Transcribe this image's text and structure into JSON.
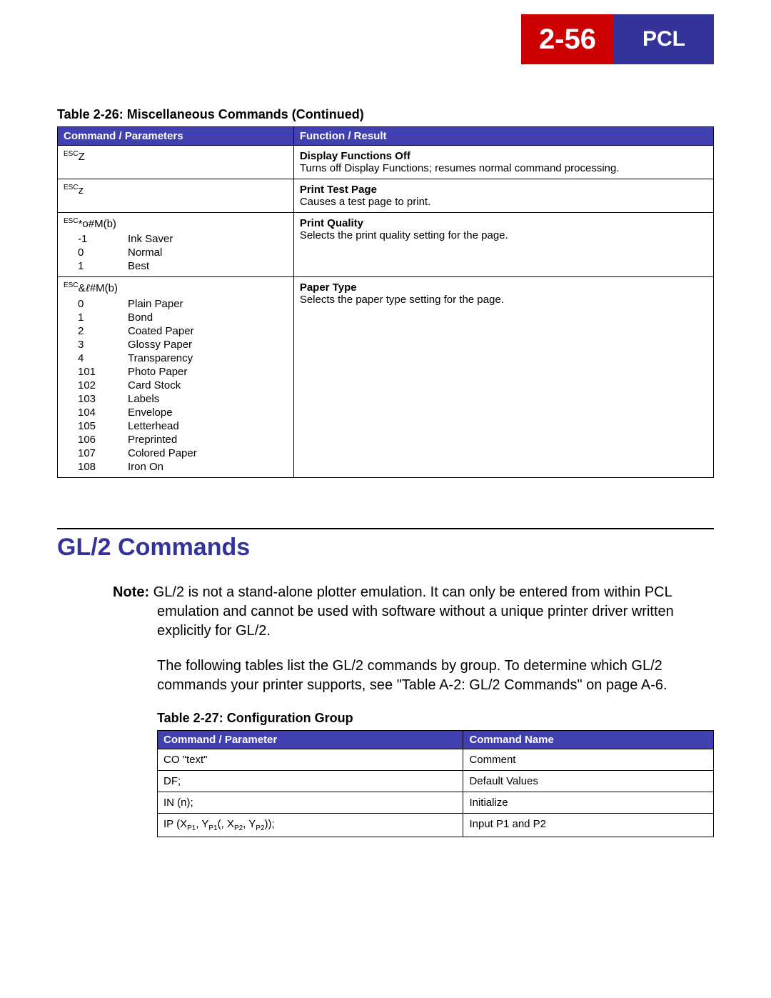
{
  "header": {
    "page_number": "2-56",
    "section": "PCL"
  },
  "table1": {
    "caption": "Table 2-26:  Miscellaneous Commands (Continued)",
    "headers": [
      "Command / Parameters",
      "Function / Result"
    ],
    "rows": [
      {
        "cmd_prefix": "ESC",
        "cmd_body": "Z",
        "params": [],
        "func_title": "Display Functions Off",
        "func_desc": "Turns off Display Functions; resumes normal command processing."
      },
      {
        "cmd_prefix": "ESC",
        "cmd_body": "z",
        "params": [],
        "func_title": "Print Test Page",
        "func_desc": "Causes a test page to print."
      },
      {
        "cmd_prefix": "ESC",
        "cmd_body": "*o#M(b)",
        "params": [
          {
            "v": "-1",
            "label": "Ink Saver"
          },
          {
            "v": "0",
            "label": "Normal"
          },
          {
            "v": "1",
            "label": "Best"
          }
        ],
        "func_title": "Print Quality",
        "func_desc": "Selects the print quality setting for the page."
      },
      {
        "cmd_prefix": "ESC",
        "cmd_body_pre": "&",
        "cmd_body_script": "ℓ",
        "cmd_body_post": "#M(b)",
        "params": [
          {
            "v": "0",
            "label": "Plain Paper"
          },
          {
            "v": "1",
            "label": "Bond"
          },
          {
            "v": "2",
            "label": "Coated Paper"
          },
          {
            "v": "3",
            "label": "Glossy Paper"
          },
          {
            "v": "4",
            "label": "Transparency"
          },
          {
            "v": "101",
            "label": "Photo Paper"
          },
          {
            "v": "102",
            "label": "Card Stock"
          },
          {
            "v": "103",
            "label": "Labels"
          },
          {
            "v": "104",
            "label": "Envelope"
          },
          {
            "v": "105",
            "label": "Letterhead"
          },
          {
            "v": "106",
            "label": "Preprinted"
          },
          {
            "v": "107",
            "label": "Colored Paper"
          },
          {
            "v": "108",
            "label": "Iron On"
          }
        ],
        "func_title": "Paper Type",
        "func_desc": "Selects the paper type setting for the page."
      }
    ]
  },
  "section": {
    "title": "GL/2 Commands",
    "note_label": "Note:",
    "note_text": "GL/2 is not a stand-alone plotter emulation. It can only be entered from within PCL emulation and cannot be used with software without a unique printer driver written explicitly for GL/2.",
    "body": "The following tables list the GL/2 commands by group. To determine which GL/2 commands your printer supports, see \"Table A-2: GL/2 Commands\" on page A-6."
  },
  "table2": {
    "caption": "Table 2-27:  Configuration Group",
    "headers": [
      "Command / Parameter",
      "Command Name"
    ],
    "rows": [
      {
        "cmd": "CO \"text\"",
        "name": "Comment"
      },
      {
        "cmd": "DF;",
        "name": "Default Values"
      },
      {
        "cmd": "IN (n);",
        "name": "Initialize"
      },
      {
        "cmd_complex": true,
        "cmd_parts": {
          "pre": "IP (X",
          "s1": "P1",
          "m1": ", Y",
          "s2": "P1",
          "m2": "(, X",
          "s3": "P2",
          "m3": ", Y",
          "s4": "P2",
          "post": "));"
        },
        "name": "Input P1 and P2"
      }
    ]
  }
}
